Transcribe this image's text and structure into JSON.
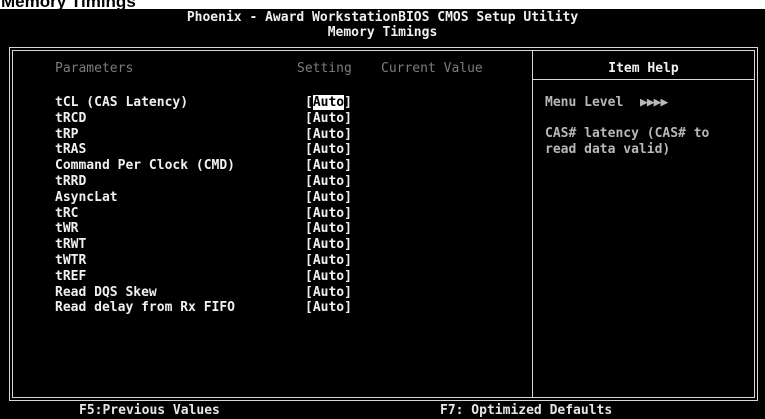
{
  "caption": "Memory Timings",
  "header": {
    "title": "Phoenix - Award WorkstationBIOS CMOS Setup Utility",
    "subtitle": "Memory Timings"
  },
  "columns": {
    "parameters": "Parameters",
    "setting": "Setting",
    "current_value": "Current Value"
  },
  "items": [
    {
      "label": "tCL (CAS Latency)",
      "value_open": "[",
      "value_text": "Auto",
      "value_close": "]",
      "selected": true
    },
    {
      "label": "tRCD",
      "value": "[Auto]"
    },
    {
      "label": "tRP",
      "value": "[Auto]"
    },
    {
      "label": "tRAS",
      "value": "[Auto]"
    },
    {
      "label": "Command Per Clock (CMD)",
      "value": "[Auto]"
    },
    {
      "label": "tRRD",
      "value": "[Auto]"
    },
    {
      "label": "AsyncLat",
      "value": "[Auto]"
    },
    {
      "label": "tRC",
      "value": "[Auto]"
    },
    {
      "label": "tWR",
      "value": "[Auto]"
    },
    {
      "label": "tRWT",
      "value": "[Auto]"
    },
    {
      "label": "tWTR",
      "value": "[Auto]"
    },
    {
      "label": "tREF",
      "value": "[Auto]"
    },
    {
      "label": "Read DQS Skew",
      "value": "[Auto]"
    },
    {
      "label": "Read delay from Rx FIFO",
      "value": "[Auto]"
    }
  ],
  "help": {
    "title": "Item Help",
    "menu_level_label": "Menu Level",
    "menu_level_arrows": "▶▶▶▶",
    "line1": "CAS# latency (CAS# to",
    "line2": "read data valid)"
  },
  "footer": {
    "f5": "F5:Previous Values",
    "f7": "F7: Optimized Defaults"
  },
  "colors": {
    "background": "#000000",
    "text": "#f0f0f0",
    "dim_text": "#7c7c7c",
    "highlight_bg": "#ffffff",
    "highlight_fg": "#000000"
  }
}
